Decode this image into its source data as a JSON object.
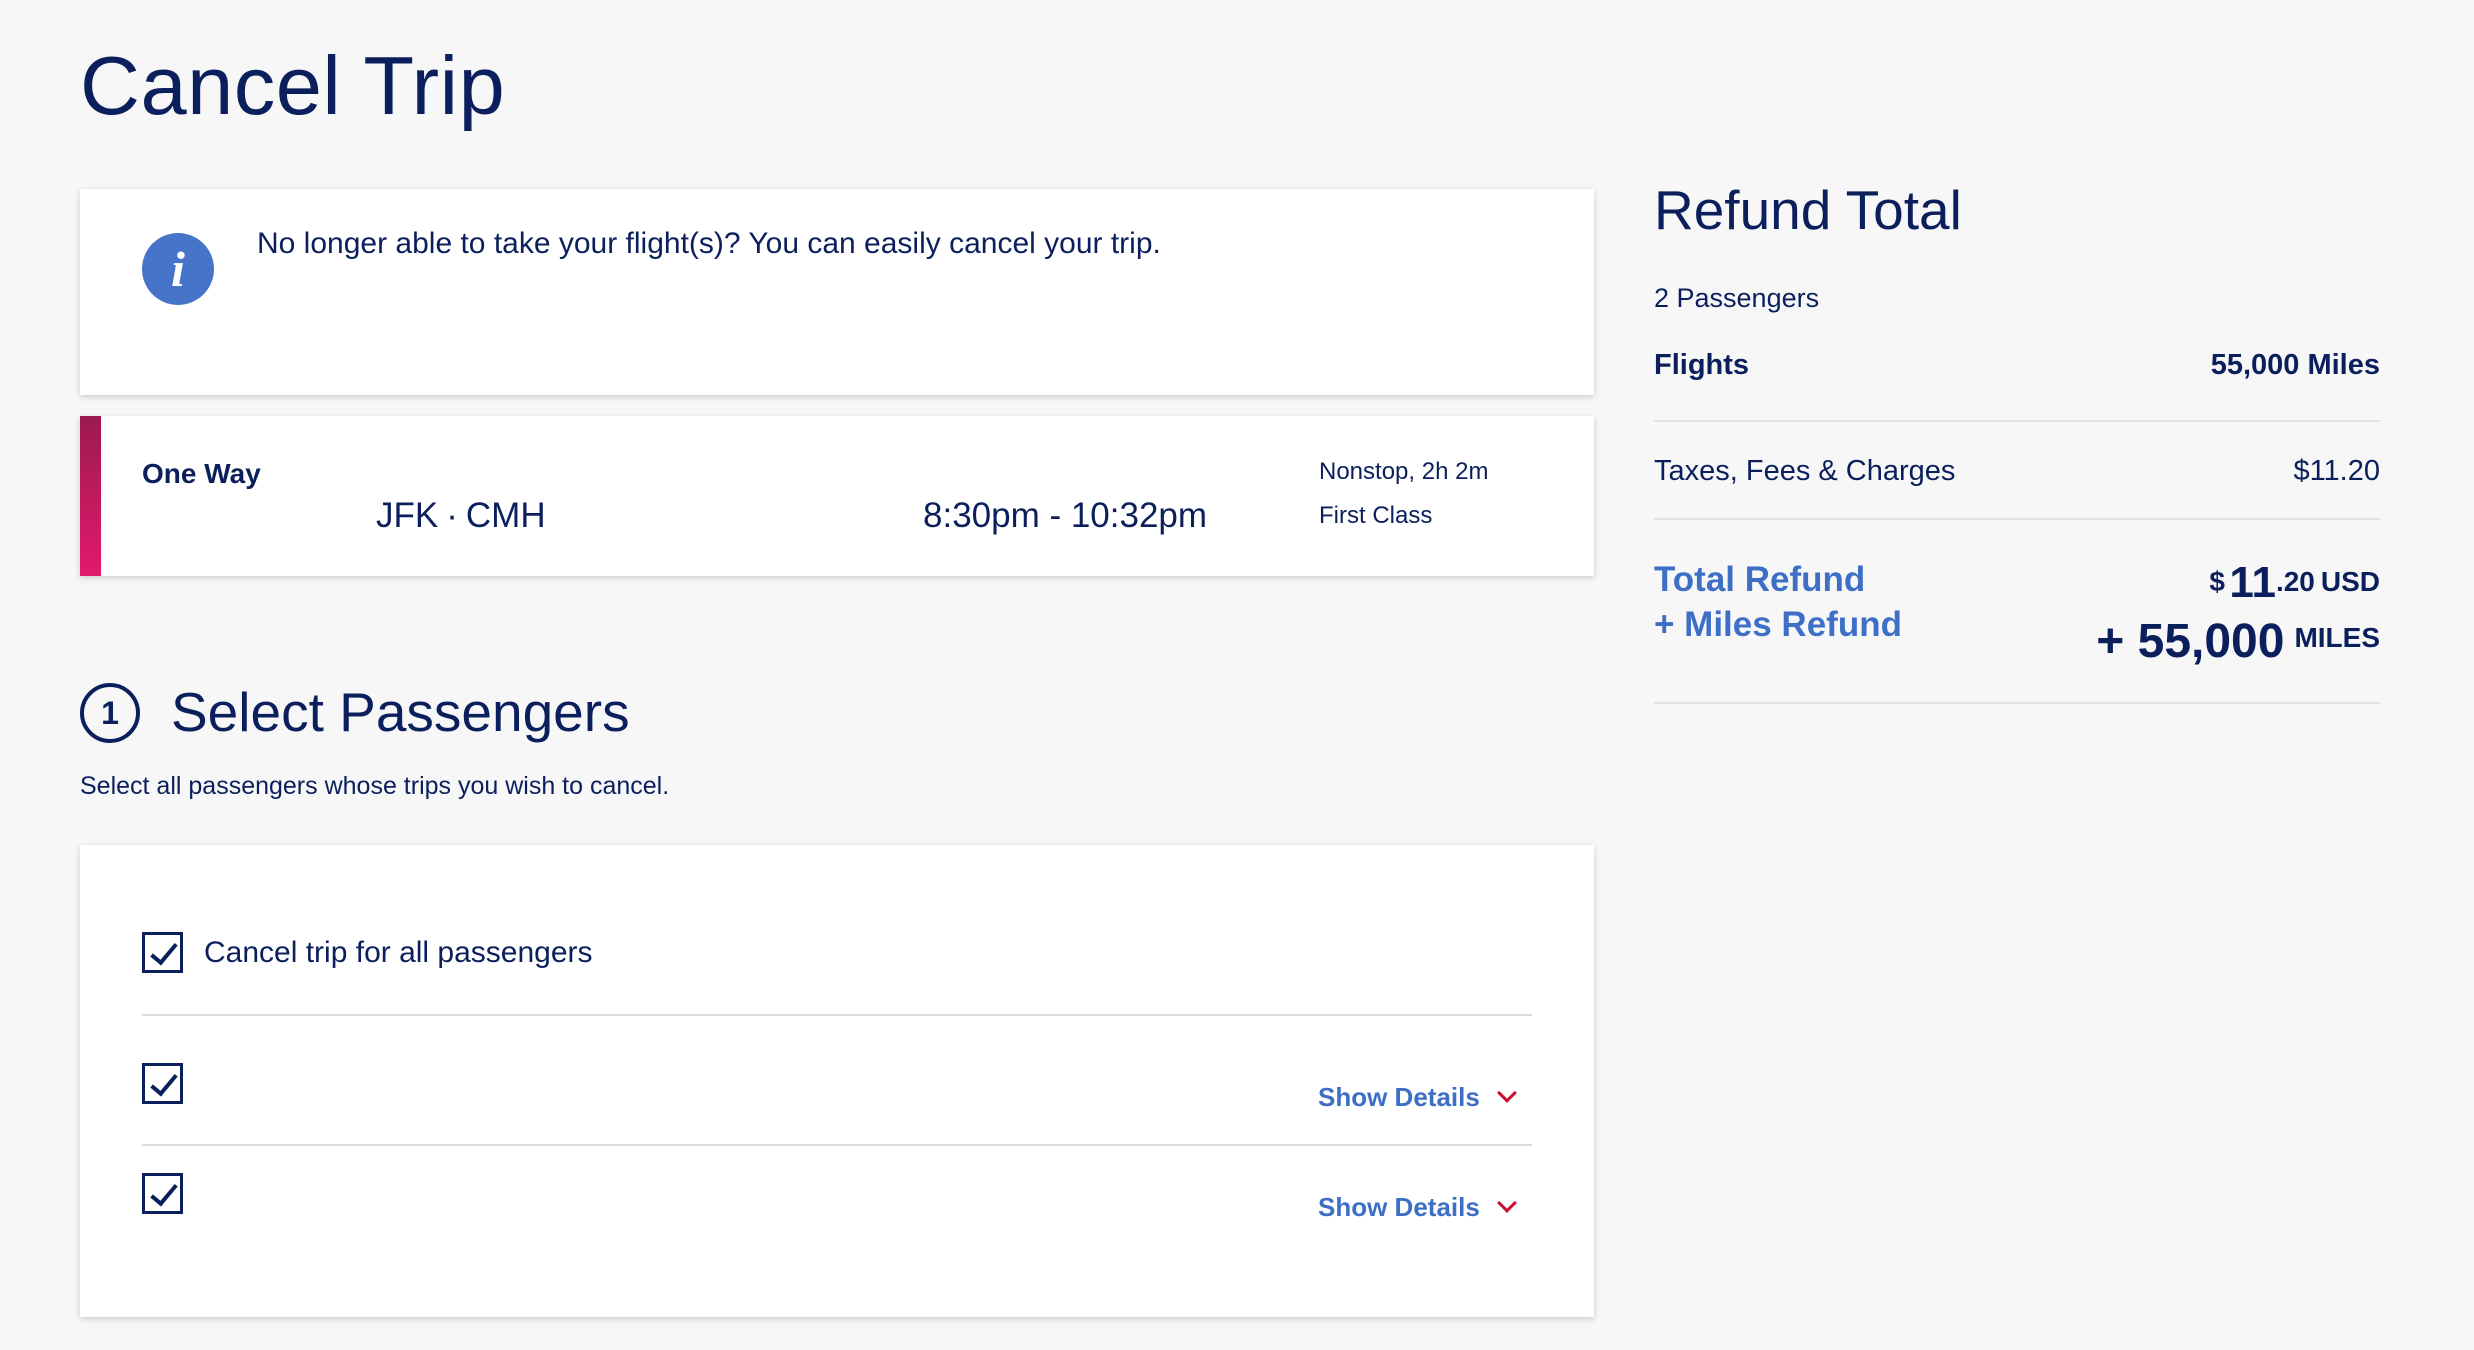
{
  "page": {
    "title": "Cancel Trip"
  },
  "info": {
    "icon": "info-icon",
    "glyph": "i",
    "text": "No longer able to take your flight(s)? You can easily cancel your trip."
  },
  "flight": {
    "trip_type": "One Way",
    "origin": "JFK",
    "separator": "·",
    "destination": "CMH",
    "times": "8:30pm - 10:32pm",
    "stops": "Nonstop, 2h 2m",
    "cabin": "First Class",
    "accent_color": "#e2196c"
  },
  "passengers_section": {
    "step": "1",
    "title": "Select Passengers",
    "subtitle": "Select all passengers whose trips you wish to cancel.",
    "select_all_label": "Cancel trip for all passengers",
    "select_all_checked": true,
    "passengers": [
      {
        "checked": true,
        "details_label": "Show Details"
      },
      {
        "checked": true,
        "details_label": "Show Details"
      }
    ]
  },
  "refund": {
    "title": "Refund Total",
    "passenger_count": "2 Passengers",
    "flights_label": "Flights",
    "flights_value": "55,000 Miles",
    "taxes_label": "Taxes, Fees & Charges",
    "taxes_value": "$11.20",
    "total_label": "Total Refund",
    "miles_label": "+ Miles Refund",
    "total_currency_symbol": "$",
    "total_dollars": "11",
    "total_cents": ".20",
    "total_currency": "USD",
    "total_miles": "+ 55,000",
    "total_miles_unit": "MILES"
  },
  "colors": {
    "navy": "#0b1f5c",
    "link_blue": "#3d6fc7",
    "chevron_red": "#c8102e",
    "info_blue": "#4674c9"
  }
}
